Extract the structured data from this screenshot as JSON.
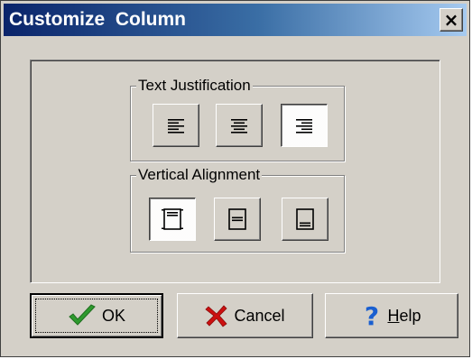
{
  "window": {
    "title": "Customize  Column",
    "close_glyph": "×"
  },
  "text_justification": {
    "label": "Text Justification",
    "options": [
      {
        "icon": "align-left-icon",
        "pressed": false
      },
      {
        "icon": "align-center-icon",
        "pressed": false
      },
      {
        "icon": "align-right-icon",
        "pressed": true
      }
    ]
  },
  "vertical_alignment": {
    "label": "Vertical Alignment",
    "options": [
      {
        "icon": "valign-top-icon",
        "pressed": true
      },
      {
        "icon": "valign-middle-icon",
        "pressed": false
      },
      {
        "icon": "valign-bottom-icon",
        "pressed": false
      }
    ]
  },
  "buttons": {
    "ok": {
      "label": "OK",
      "icon": "checkmark-icon",
      "icon_color": "#2e9a2e",
      "default": true
    },
    "cancel": {
      "label": "Cancel",
      "icon": "red-x-icon",
      "icon_color": "#cc1010"
    },
    "help": {
      "label_underlined": "H",
      "label_rest": "elp",
      "icon": "question-mark-icon",
      "icon_color": "#1a5fd0"
    }
  },
  "colors": {
    "title_gradient_start": "#0a246a",
    "title_gradient_end": "#a6caf0",
    "face": "#d4d0c8"
  }
}
